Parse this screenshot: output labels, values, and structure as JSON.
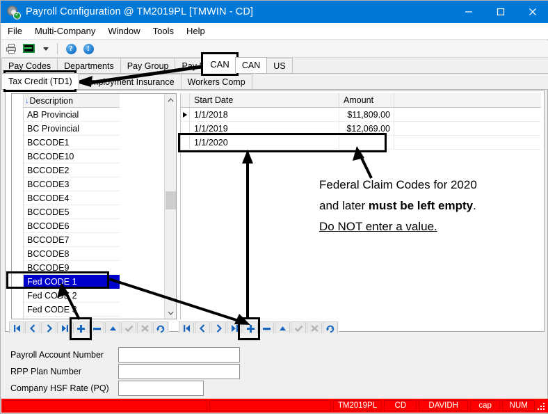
{
  "window": {
    "title": "Payroll Configuration @ TM2019PL [TMWIN - CD]",
    "icon": "gear-check-icon",
    "minimize": "–",
    "maximize": "□",
    "close": "✕"
  },
  "menubar": {
    "items": [
      {
        "label": "File"
      },
      {
        "label": "Multi-Company"
      },
      {
        "label": "Window"
      },
      {
        "label": "Tools"
      },
      {
        "label": "Help"
      }
    ]
  },
  "toolbar": {
    "buttons": [
      {
        "name": "print-icon",
        "glyph": "printer"
      },
      {
        "name": "print-preview-icon",
        "glyph": "monitor"
      },
      {
        "name": "chevron-down-icon",
        "glyph": "caret"
      },
      {
        "name": "help-icon",
        "glyph": "question",
        "char": "?"
      },
      {
        "name": "info-icon",
        "glyph": "info",
        "char": "!"
      }
    ]
  },
  "tabs": {
    "row1": [
      {
        "label": "Pay Codes",
        "active": false
      },
      {
        "label": "Departments",
        "active": false
      },
      {
        "label": "Pay Group",
        "active": false
      },
      {
        "label": "Pay Periods",
        "active": false
      },
      {
        "label": "CAN",
        "active": true
      },
      {
        "label": "US",
        "active": false
      }
    ],
    "row2": [
      {
        "label": "Tax Credit (TD1)",
        "active": true
      },
      {
        "label": "Employment Insurance",
        "active": false
      },
      {
        "label": "Workers Comp",
        "active": false
      }
    ]
  },
  "list": {
    "header": "Description",
    "sort_indicator": "↓",
    "rows": [
      {
        "label": "AB Provincial",
        "selected": false
      },
      {
        "label": "BC Provincial",
        "selected": false
      },
      {
        "label": "BCCODE1",
        "selected": false
      },
      {
        "label": "BCCODE10",
        "selected": false
      },
      {
        "label": "BCCODE2",
        "selected": false
      },
      {
        "label": "BCCODE3",
        "selected": false
      },
      {
        "label": "BCCODE4",
        "selected": false
      },
      {
        "label": "BCCODE5",
        "selected": false
      },
      {
        "label": "BCCODE6",
        "selected": false
      },
      {
        "label": "BCCODE7",
        "selected": false
      },
      {
        "label": "BCCODE8",
        "selected": false
      },
      {
        "label": "BCCODE9",
        "selected": false
      },
      {
        "label": "Fed CODE 1",
        "selected": true
      },
      {
        "label": "Fed CODE 2",
        "selected": false
      },
      {
        "label": "Fed CODE 3",
        "selected": false
      }
    ]
  },
  "grid": {
    "columns": [
      "Start Date",
      "Amount"
    ],
    "rows": [
      {
        "start_date": "1/1/2018",
        "amount": "$11,809.00",
        "current": true
      },
      {
        "start_date": "1/1/2019",
        "amount": "$12,069.00",
        "current": false
      },
      {
        "start_date": "1/1/2020",
        "amount": "",
        "current": false
      }
    ]
  },
  "navigator": {
    "buttons": [
      {
        "name": "first-record-button",
        "title": "First"
      },
      {
        "name": "prior-record-button",
        "title": "Prior"
      },
      {
        "name": "next-record-button",
        "title": "Next"
      },
      {
        "name": "last-record-button",
        "title": "Last"
      },
      {
        "name": "insert-record-button",
        "title": "Insert"
      },
      {
        "name": "delete-record-button",
        "title": "Delete"
      },
      {
        "name": "edit-record-button",
        "title": "Edit"
      },
      {
        "name": "post-edit-button",
        "title": "Post"
      },
      {
        "name": "cancel-edit-button",
        "title": "Cancel"
      },
      {
        "name": "refresh-button",
        "title": "Refresh"
      }
    ]
  },
  "form": {
    "fields": [
      {
        "label": "Payroll Account Number",
        "value": "",
        "placeholder": ""
      },
      {
        "label": "RPP Plan Number",
        "value": "",
        "placeholder": ""
      },
      {
        "label": "Company HSF Rate (PQ)",
        "value": "",
        "placeholder": ""
      }
    ]
  },
  "statusbar": {
    "panels": [
      "TM2019PL",
      "CD",
      "DAVIDH",
      "cap",
      "NUM"
    ]
  },
  "annotations": {
    "callout_can": "CAN",
    "callout_tax_credit": "Tax Credit (TD1)",
    "note_line1": "Federal Claim Codes for 2020",
    "note_line2_pre": "and later ",
    "note_line2_bold": "must be left empty",
    "note_line2_post": ".",
    "note_line3": "Do NOT enter a value."
  },
  "colors": {
    "titlebar": "#0078d7",
    "selection": "#0000cd",
    "statusbar": "#ff0000",
    "annotation": "#000000"
  }
}
